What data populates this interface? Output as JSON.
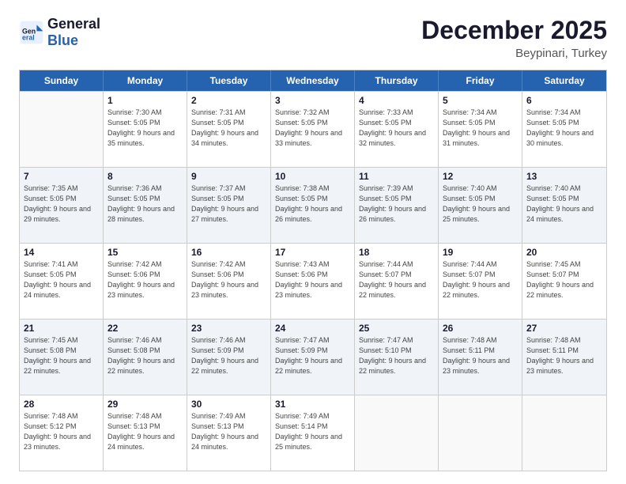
{
  "logo": {
    "text_general": "General",
    "text_blue": "Blue"
  },
  "header": {
    "title": "December 2025",
    "subtitle": "Beypinari, Turkey"
  },
  "calendar": {
    "days_of_week": [
      "Sunday",
      "Monday",
      "Tuesday",
      "Wednesday",
      "Thursday",
      "Friday",
      "Saturday"
    ],
    "weeks": [
      [
        {
          "day": "",
          "empty": true
        },
        {
          "day": "1",
          "sunrise": "Sunrise: 7:30 AM",
          "sunset": "Sunset: 5:05 PM",
          "daylight": "Daylight: 9 hours and 35 minutes."
        },
        {
          "day": "2",
          "sunrise": "Sunrise: 7:31 AM",
          "sunset": "Sunset: 5:05 PM",
          "daylight": "Daylight: 9 hours and 34 minutes."
        },
        {
          "day": "3",
          "sunrise": "Sunrise: 7:32 AM",
          "sunset": "Sunset: 5:05 PM",
          "daylight": "Daylight: 9 hours and 33 minutes."
        },
        {
          "day": "4",
          "sunrise": "Sunrise: 7:33 AM",
          "sunset": "Sunset: 5:05 PM",
          "daylight": "Daylight: 9 hours and 32 minutes."
        },
        {
          "day": "5",
          "sunrise": "Sunrise: 7:34 AM",
          "sunset": "Sunset: 5:05 PM",
          "daylight": "Daylight: 9 hours and 31 minutes."
        },
        {
          "day": "6",
          "sunrise": "Sunrise: 7:34 AM",
          "sunset": "Sunset: 5:05 PM",
          "daylight": "Daylight: 9 hours and 30 minutes."
        }
      ],
      [
        {
          "day": "7",
          "sunrise": "Sunrise: 7:35 AM",
          "sunset": "Sunset: 5:05 PM",
          "daylight": "Daylight: 9 hours and 29 minutes."
        },
        {
          "day": "8",
          "sunrise": "Sunrise: 7:36 AM",
          "sunset": "Sunset: 5:05 PM",
          "daylight": "Daylight: 9 hours and 28 minutes."
        },
        {
          "day": "9",
          "sunrise": "Sunrise: 7:37 AM",
          "sunset": "Sunset: 5:05 PM",
          "daylight": "Daylight: 9 hours and 27 minutes."
        },
        {
          "day": "10",
          "sunrise": "Sunrise: 7:38 AM",
          "sunset": "Sunset: 5:05 PM",
          "daylight": "Daylight: 9 hours and 26 minutes."
        },
        {
          "day": "11",
          "sunrise": "Sunrise: 7:39 AM",
          "sunset": "Sunset: 5:05 PM",
          "daylight": "Daylight: 9 hours and 26 minutes."
        },
        {
          "day": "12",
          "sunrise": "Sunrise: 7:40 AM",
          "sunset": "Sunset: 5:05 PM",
          "daylight": "Daylight: 9 hours and 25 minutes."
        },
        {
          "day": "13",
          "sunrise": "Sunrise: 7:40 AM",
          "sunset": "Sunset: 5:05 PM",
          "daylight": "Daylight: 9 hours and 24 minutes."
        }
      ],
      [
        {
          "day": "14",
          "sunrise": "Sunrise: 7:41 AM",
          "sunset": "Sunset: 5:05 PM",
          "daylight": "Daylight: 9 hours and 24 minutes."
        },
        {
          "day": "15",
          "sunrise": "Sunrise: 7:42 AM",
          "sunset": "Sunset: 5:06 PM",
          "daylight": "Daylight: 9 hours and 23 minutes."
        },
        {
          "day": "16",
          "sunrise": "Sunrise: 7:42 AM",
          "sunset": "Sunset: 5:06 PM",
          "daylight": "Daylight: 9 hours and 23 minutes."
        },
        {
          "day": "17",
          "sunrise": "Sunrise: 7:43 AM",
          "sunset": "Sunset: 5:06 PM",
          "daylight": "Daylight: 9 hours and 23 minutes."
        },
        {
          "day": "18",
          "sunrise": "Sunrise: 7:44 AM",
          "sunset": "Sunset: 5:07 PM",
          "daylight": "Daylight: 9 hours and 22 minutes."
        },
        {
          "day": "19",
          "sunrise": "Sunrise: 7:44 AM",
          "sunset": "Sunset: 5:07 PM",
          "daylight": "Daylight: 9 hours and 22 minutes."
        },
        {
          "day": "20",
          "sunrise": "Sunrise: 7:45 AM",
          "sunset": "Sunset: 5:07 PM",
          "daylight": "Daylight: 9 hours and 22 minutes."
        }
      ],
      [
        {
          "day": "21",
          "sunrise": "Sunrise: 7:45 AM",
          "sunset": "Sunset: 5:08 PM",
          "daylight": "Daylight: 9 hours and 22 minutes."
        },
        {
          "day": "22",
          "sunrise": "Sunrise: 7:46 AM",
          "sunset": "Sunset: 5:08 PM",
          "daylight": "Daylight: 9 hours and 22 minutes."
        },
        {
          "day": "23",
          "sunrise": "Sunrise: 7:46 AM",
          "sunset": "Sunset: 5:09 PM",
          "daylight": "Daylight: 9 hours and 22 minutes."
        },
        {
          "day": "24",
          "sunrise": "Sunrise: 7:47 AM",
          "sunset": "Sunset: 5:09 PM",
          "daylight": "Daylight: 9 hours and 22 minutes."
        },
        {
          "day": "25",
          "sunrise": "Sunrise: 7:47 AM",
          "sunset": "Sunset: 5:10 PM",
          "daylight": "Daylight: 9 hours and 22 minutes."
        },
        {
          "day": "26",
          "sunrise": "Sunrise: 7:48 AM",
          "sunset": "Sunset: 5:11 PM",
          "daylight": "Daylight: 9 hours and 23 minutes."
        },
        {
          "day": "27",
          "sunrise": "Sunrise: 7:48 AM",
          "sunset": "Sunset: 5:11 PM",
          "daylight": "Daylight: 9 hours and 23 minutes."
        }
      ],
      [
        {
          "day": "28",
          "sunrise": "Sunrise: 7:48 AM",
          "sunset": "Sunset: 5:12 PM",
          "daylight": "Daylight: 9 hours and 23 minutes."
        },
        {
          "day": "29",
          "sunrise": "Sunrise: 7:48 AM",
          "sunset": "Sunset: 5:13 PM",
          "daylight": "Daylight: 9 hours and 24 minutes."
        },
        {
          "day": "30",
          "sunrise": "Sunrise: 7:49 AM",
          "sunset": "Sunset: 5:13 PM",
          "daylight": "Daylight: 9 hours and 24 minutes."
        },
        {
          "day": "31",
          "sunrise": "Sunrise: 7:49 AM",
          "sunset": "Sunset: 5:14 PM",
          "daylight": "Daylight: 9 hours and 25 minutes."
        },
        {
          "day": "",
          "empty": true
        },
        {
          "day": "",
          "empty": true
        },
        {
          "day": "",
          "empty": true
        }
      ]
    ]
  }
}
